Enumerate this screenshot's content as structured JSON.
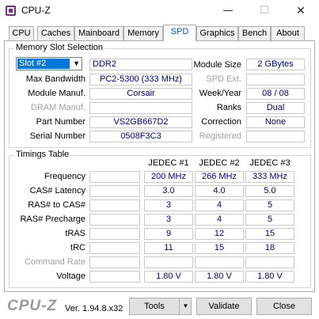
{
  "window": {
    "title": "CPU-Z",
    "minimize_glyph": "—",
    "maximize_glyph": "☐",
    "close_glyph": "✕"
  },
  "tabs": [
    "CPU",
    "Caches",
    "Mainboard",
    "Memory",
    "SPD",
    "Graphics",
    "Bench",
    "About"
  ],
  "active_tab": "SPD",
  "slot_section": {
    "title": "Memory Slot Selection",
    "slot_selected": "Slot #2",
    "type": "DDR2",
    "max_bandwidth_label": "Max Bandwidth",
    "max_bandwidth": "PC2-5300 (333 MHz)",
    "module_manuf_label": "Module Manuf.",
    "module_manuf": "Corsair",
    "dram_manuf_label": "DRAM Manuf.",
    "dram_manuf": "",
    "part_number_label": "Part Number",
    "part_number": "VS2GB667D2",
    "serial_number_label": "Serial Number",
    "serial_number": "0508F3C3",
    "module_size_label": "Module Size",
    "module_size": "2 GBytes",
    "spd_ext_label": "SPD Ext.",
    "spd_ext": "",
    "week_year_label": "Week/Year",
    "week_year": "08 / 08",
    "ranks_label": "Ranks",
    "ranks": "Dual",
    "correction_label": "Correction",
    "correction": "None",
    "registered_label": "Registered",
    "registered": ""
  },
  "timings": {
    "title": "Timings Table",
    "columns": [
      "JEDEC #1",
      "JEDEC #2",
      "JEDEC #3"
    ],
    "rows": [
      {
        "label": "Frequency",
        "values": [
          "200 MHz",
          "266 MHz",
          "333 MHz"
        ],
        "dim": false
      },
      {
        "label": "CAS# Latency",
        "values": [
          "3.0",
          "4.0",
          "5.0"
        ],
        "dim": false
      },
      {
        "label": "RAS# to CAS#",
        "values": [
          "3",
          "4",
          "5"
        ],
        "dim": false
      },
      {
        "label": "RAS# Precharge",
        "values": [
          "3",
          "4",
          "5"
        ],
        "dim": false
      },
      {
        "label": "tRAS",
        "values": [
          "9",
          "12",
          "15"
        ],
        "dim": false
      },
      {
        "label": "tRC",
        "values": [
          "11",
          "15",
          "18"
        ],
        "dim": false
      },
      {
        "label": "Command Rate",
        "values": [
          "",
          "",
          ""
        ],
        "dim": true
      },
      {
        "label": "Voltage",
        "values": [
          "1.80 V",
          "1.80 V",
          "1.80 V"
        ],
        "dim": false
      }
    ]
  },
  "footer": {
    "logo": "CPU-Z",
    "version": "Ver. 1.94.8.x32",
    "tools_label": "Tools",
    "validate_label": "Validate",
    "close_label": "Close"
  },
  "colors": {
    "value_text": "#00007f",
    "active_tab_text": "#0055b8",
    "select_highlight": "#0078d7"
  }
}
